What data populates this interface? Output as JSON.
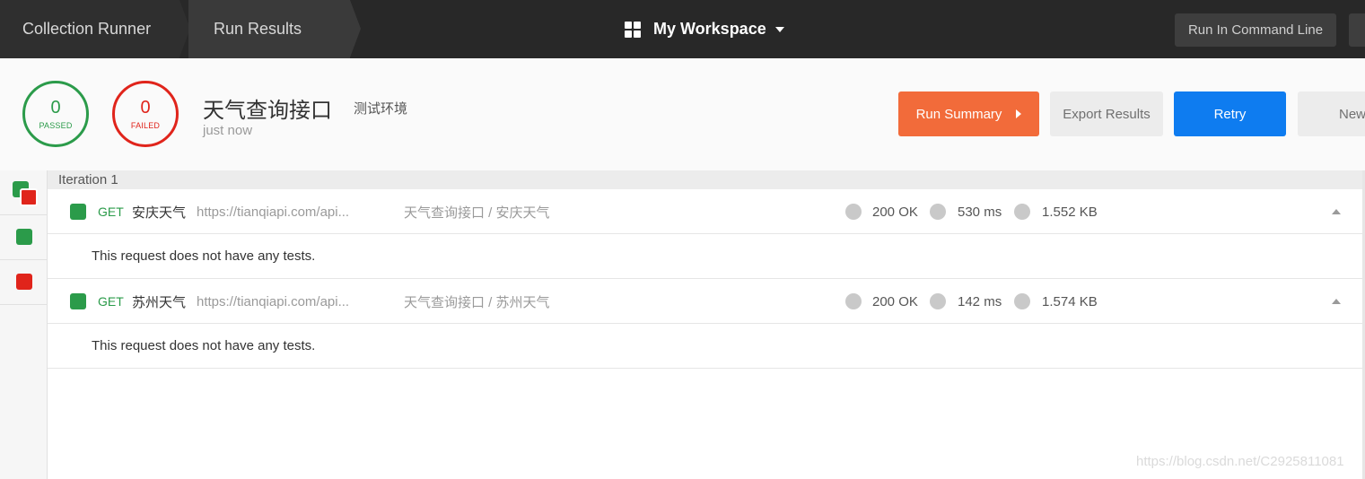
{
  "topbar": {
    "crumbs": [
      "Collection Runner",
      "Run Results"
    ],
    "workspace": "My Workspace",
    "command_line_label": "Run In Command Line"
  },
  "summary": {
    "passed": {
      "count": "0",
      "label": "PASSED"
    },
    "failed": {
      "count": "0",
      "label": "FAILED"
    },
    "collection_name": "天气查询接口",
    "environment": "测试环境",
    "time": "just now",
    "buttons": {
      "run_summary": "Run Summary",
      "export": "Export Results",
      "retry": "Retry",
      "new": "New"
    }
  },
  "iteration_label": "Iteration 1",
  "requests": [
    {
      "method": "GET",
      "name": "安庆天气",
      "url": "https://tianqiapi.com/api...",
      "path": "天气查询接口 / 安庆天气",
      "status": "200 OK",
      "time": "530 ms",
      "size": "1.552 KB",
      "note": "This request does not have any tests."
    },
    {
      "method": "GET",
      "name": "苏州天气",
      "url": "https://tianqiapi.com/api...",
      "path": "天气查询接口 / 苏州天气",
      "status": "200 OK",
      "time": "142 ms",
      "size": "1.574 KB",
      "note": "This request does not have any tests."
    }
  ],
  "colors": {
    "pass": "#2b9b4a",
    "fail": "#e0241b",
    "accent": "#f26b3a",
    "primary": "#0e7cf0"
  },
  "watermark": "https://blog.csdn.net/C2925811081"
}
